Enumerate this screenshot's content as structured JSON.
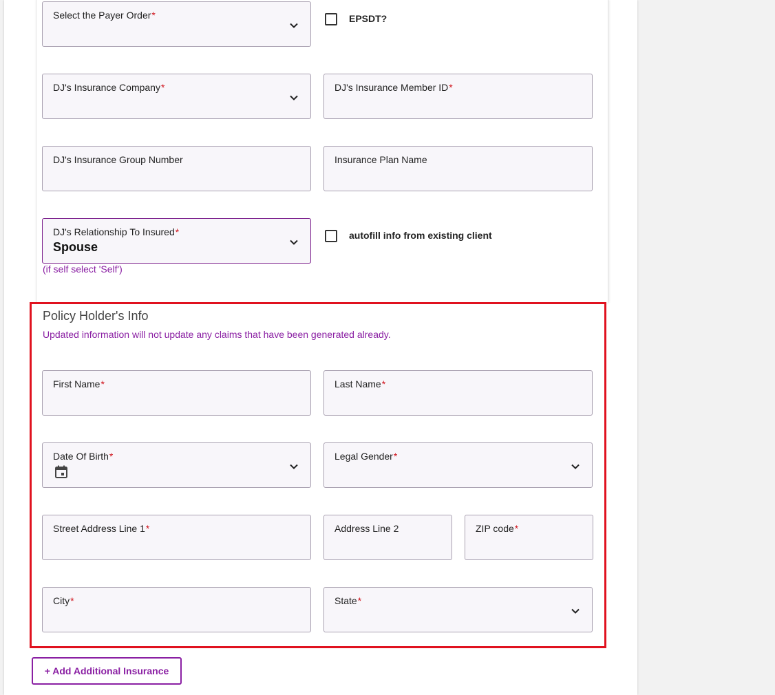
{
  "fields": {
    "payer_order": {
      "label": "Select the Payer Order",
      "required": "*"
    },
    "insurance_company": {
      "label": "DJ's Insurance Company",
      "required": "*"
    },
    "member_id": {
      "label": "DJ's Insurance Member ID",
      "required": "*"
    },
    "group_number": {
      "label": "DJ's Insurance Group Number"
    },
    "plan_name": {
      "label": "Insurance Plan Name"
    },
    "relationship": {
      "label": "DJ's Relationship To Insured",
      "required": "*",
      "value": "Spouse",
      "hint": "(if self select 'Self')"
    }
  },
  "checkboxes": {
    "epsdt": {
      "label": "EPSDT?",
      "checked": false
    },
    "autofill": {
      "label": "autofill info from existing client",
      "checked": false
    }
  },
  "policy_holder": {
    "title": "Policy Holder's Info",
    "note": "Updated information will not update any claims that have been generated already.",
    "first_name": {
      "label": "First Name",
      "required": "*"
    },
    "last_name": {
      "label": "Last Name",
      "required": "*"
    },
    "dob": {
      "label": "Date Of Birth",
      "required": "*"
    },
    "gender": {
      "label": "Legal Gender",
      "required": "*"
    },
    "street1": {
      "label": "Street Address Line 1",
      "required": "*"
    },
    "address2": {
      "label": "Address Line 2"
    },
    "zip": {
      "label": "ZIP code",
      "required": "*"
    },
    "city": {
      "label": "City",
      "required": "*"
    },
    "state": {
      "label": "State",
      "required": "*"
    }
  },
  "actions": {
    "add_insurance": "+ Add Additional Insurance"
  },
  "colors": {
    "accent": "#8a1fa3",
    "required": "#d0141c",
    "highlight_box": "#e0121f",
    "field_bg": "#f8f6fa"
  },
  "icons": {
    "dropdown": "chevron-down-icon",
    "date": "calendar-icon"
  }
}
